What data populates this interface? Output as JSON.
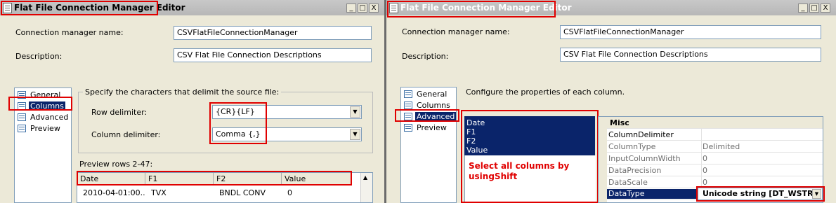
{
  "left": {
    "title": "Flat File Connection Manager Editor",
    "window_buttons": [
      "_",
      "□",
      "X"
    ],
    "conn_name_label": "Connection manager name:",
    "conn_name_value": "CSVFlatFileConnectionManager",
    "desc_label": "Description:",
    "desc_value": "CSV Flat File Connection Descriptions",
    "nav": [
      "General",
      "Columns",
      "Advanced",
      "Preview"
    ],
    "selected_nav": "Columns",
    "group_title": "Specify the characters that delimit the source file:",
    "row_delim_label": "Row delimiter:",
    "row_delim_value": "{CR}{LF}",
    "col_delim_label": "Column delimiter:",
    "col_delim_value": "Comma {,}",
    "preview_label": "Preview rows 2-47:",
    "preview_headers": [
      "Date",
      "F1",
      "F2",
      "Value"
    ],
    "preview_rows": [
      [
        "2010-04-01:00...",
        "TVX",
        "BNDL CONV",
        "0"
      ]
    ]
  },
  "right": {
    "title": "Flat File Connection Manager Editor",
    "window_buttons": [
      "_",
      "□",
      "X"
    ],
    "conn_name_label": "Connection manager name:",
    "conn_name_value": "CSVFlatFileConnectionManager",
    "desc_label": "Description:",
    "desc_value": "CSV Flat File Connection Descriptions",
    "nav": [
      "General",
      "Columns",
      "Advanced",
      "Preview"
    ],
    "selected_nav": "Advanced",
    "configure_text": "Configure the properties of each column.",
    "columns": [
      "Date",
      "F1",
      "F2",
      "Value"
    ],
    "annotation_line1": "Select all columns by",
    "annotation_line2": "usingShift",
    "section": "Misc",
    "section_toggle": "⊟",
    "props": [
      {
        "name": "ColumnDelimiter",
        "value": ""
      },
      {
        "name": "ColumnType",
        "value": "Delimited"
      },
      {
        "name": "InputColumnWidth",
        "value": "0"
      },
      {
        "name": "DataPrecision",
        "value": "0"
      },
      {
        "name": "DataScale",
        "value": "0"
      },
      {
        "name": "DataType",
        "value": "Unicode string [DT_WSTR]"
      }
    ]
  },
  "colors": {
    "highlight": "#e00000",
    "selection": "#0a246a",
    "annotation": "#e00000"
  }
}
